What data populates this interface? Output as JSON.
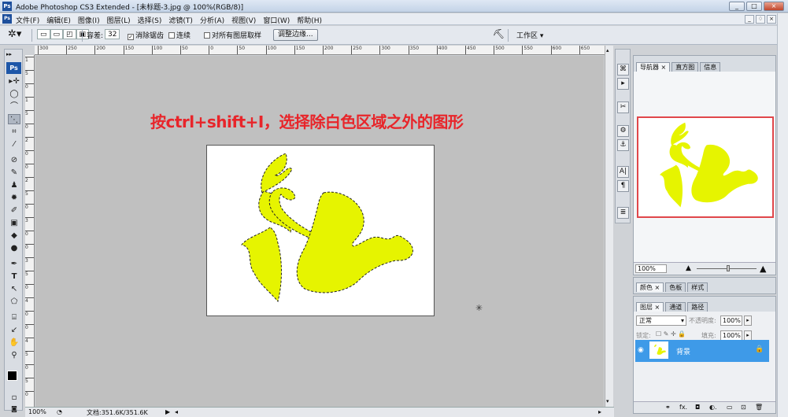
{
  "window": {
    "app_icon": "Ps",
    "title": "Adobe Photoshop CS3 Extended - [未标题-3.jpg @ 100%(RGB/8)]",
    "controls": [
      "_",
      "□",
      "×"
    ]
  },
  "menubar": {
    "items": [
      "文件(F)",
      "编辑(E)",
      "图像(I)",
      "图层(L)",
      "选择(S)",
      "滤镜(T)",
      "分析(A)",
      "视图(V)",
      "窗口(W)",
      "帮助(H)"
    ],
    "doc_controls": [
      "_",
      "♢",
      "×"
    ]
  },
  "options": {
    "tolerance_label": "容差:",
    "tolerance_value": "32",
    "antialias_label": "消除锯齿",
    "contiguous_label": "连续",
    "sample_all_label": "对所有图层取样",
    "refine_edge_button": "调整边缘...",
    "workspace_label": "工作区 ▾"
  },
  "ruler": {
    "h_ticks": [
      "300",
      "250",
      "200",
      "150",
      "100",
      "50",
      "0",
      "50",
      "100",
      "150",
      "200",
      "250",
      "300",
      "350",
      "400",
      "450",
      "500",
      "550",
      "600",
      "650"
    ],
    "v_ticks": [
      "1",
      "5",
      "0",
      "1",
      "5",
      "0",
      "2",
      "0",
      "0",
      "2",
      "5",
      "0",
      "3",
      "0",
      "0",
      "3",
      "5",
      "0",
      "4",
      "0",
      "0",
      "4",
      "5",
      "0",
      "5",
      "0"
    ]
  },
  "canvas": {
    "headline": "按ctrl+shift+I，选择除白色区域之外的图形",
    "shape_color": "#e6f400",
    "bg_color": "#c0c0c0"
  },
  "statusbar": {
    "zoom": "100%",
    "doc_info": "文档:351.6K/351.6K"
  },
  "toolbox": {
    "logo": "Ps",
    "tools": [
      "▸✛",
      "◯",
      "⌒",
      "⋱",
      "⌗",
      "⁄",
      "⊘",
      "✎",
      "♟",
      "✹",
      "✐",
      "▣",
      "◆",
      "●",
      "✒",
      "T",
      "↖",
      "⬠",
      "⌸",
      "↙",
      "✋",
      "⚲",
      "▪",
      "▫",
      "◙"
    ]
  },
  "dock_icons": [
    "⌘",
    "▸",
    "✂",
    "⚙",
    "⚓",
    "A|",
    "¶",
    "≣"
  ],
  "navigator": {
    "tabs": [
      "导航器 ×",
      "直方图",
      "信息"
    ],
    "zoom": "100%"
  },
  "color_panel": {
    "tabs": [
      "颜色 ×",
      "色板",
      "样式"
    ]
  },
  "layers_panel": {
    "tabs": [
      "图层 ×",
      "通道",
      "路径"
    ],
    "blend_mode": "正常",
    "opacity_label": "不透明度:",
    "opacity_value": "100%",
    "lock_label": "锁定:",
    "fill_label": "填充:",
    "fill_value": "100%",
    "layer_name": "背景",
    "bottom_icons": [
      "⚭",
      "fx.",
      "◘",
      "◐.",
      "▭",
      "⊡",
      "🗑"
    ]
  }
}
